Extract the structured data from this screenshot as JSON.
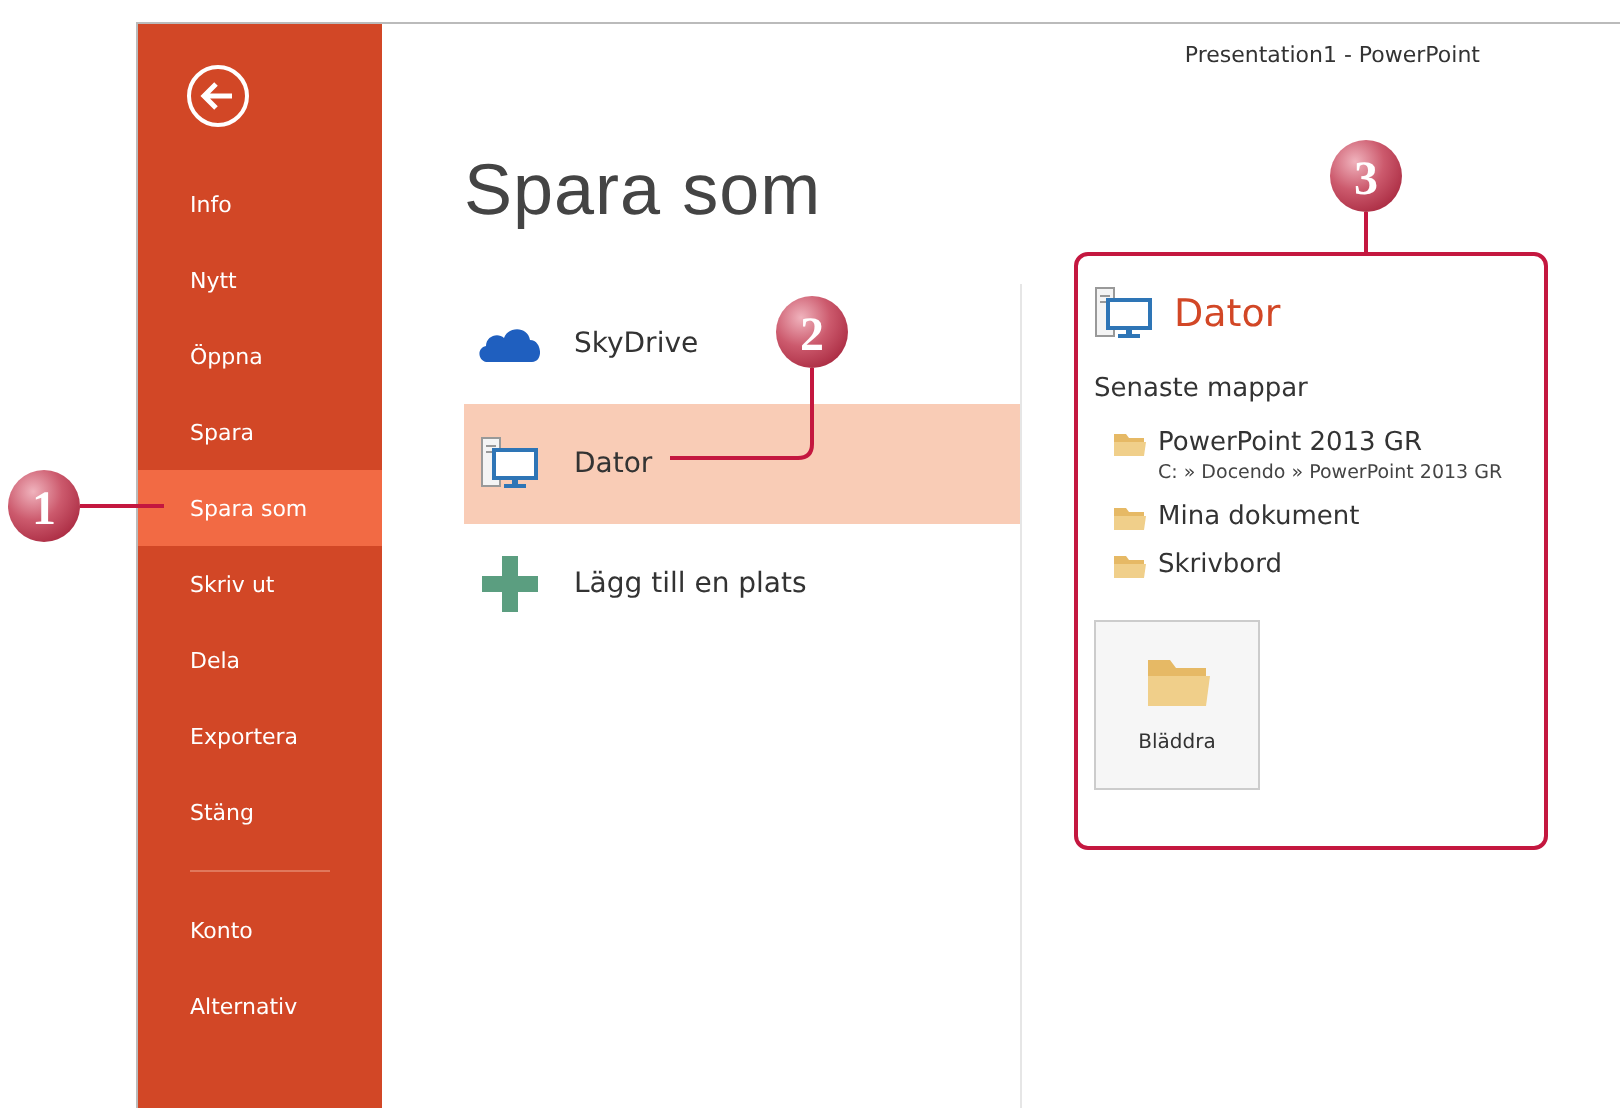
{
  "window": {
    "title": "Presentation1 - PowerPoint"
  },
  "sidebar": {
    "items": [
      {
        "label": "Info",
        "selected": false
      },
      {
        "label": "Nytt",
        "selected": false
      },
      {
        "label": "Öppna",
        "selected": false
      },
      {
        "label": "Spara",
        "selected": false
      },
      {
        "label": "Spara som",
        "selected": true
      },
      {
        "label": "Skriv ut",
        "selected": false
      },
      {
        "label": "Dela",
        "selected": false
      },
      {
        "label": "Exportera",
        "selected": false
      },
      {
        "label": "Stäng",
        "selected": false
      }
    ],
    "footer_items": [
      {
        "label": "Konto",
        "selected": false
      },
      {
        "label": "Alternativ",
        "selected": false
      }
    ]
  },
  "heading": "Spara som",
  "places": [
    {
      "kind": "cloud",
      "label": "SkyDrive",
      "selected": false
    },
    {
      "kind": "computer",
      "label": "Dator",
      "selected": true
    },
    {
      "kind": "add",
      "label": "Lägg till en plats",
      "selected": false
    }
  ],
  "detail": {
    "title": "Dator",
    "section": "Senaste mappar",
    "folders": [
      {
        "name": "PowerPoint 2013 GR",
        "path": "C: » Docendo » PowerPoint 2013 GR"
      },
      {
        "name": "Mina dokument"
      },
      {
        "name": "Skrivbord"
      }
    ],
    "browse_button": "Bläddra"
  },
  "callouts": [
    {
      "label": "1"
    },
    {
      "label": "2"
    },
    {
      "label": "3"
    }
  ]
}
